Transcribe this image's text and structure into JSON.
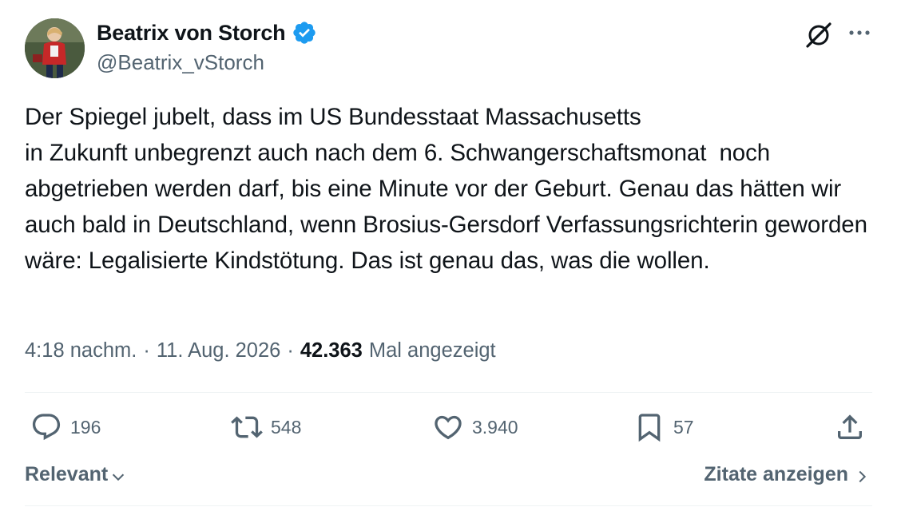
{
  "author": {
    "name": "Beatrix von Storch",
    "handle": "@Beatrix_vStorch",
    "verified_color": "#1d9bf0"
  },
  "tweet": {
    "text": "Der Spiegel jubelt, dass im US Bundesstaat Massachusetts\nin Zukunft unbegrenzt auch nach dem 6. Schwangerschaftsmonat  noch abgetrieben werden darf, bis eine Minute vor der Geburt. Genau das hätten wir auch bald in Deutschland, wenn Brosius-Gersdorf Verfassungsrichterin geworden wäre: Legalisierte Kindstötung. Das ist genau das, was die wollen.",
    "time": "4:18 nachm.",
    "date": "11. Aug. 2026",
    "separator": "·",
    "views": "42.363",
    "views_label": "Mal angezeigt"
  },
  "actions": {
    "replies": "196",
    "retweets": "548",
    "likes": "3.940",
    "bookmarks": "57"
  },
  "footer": {
    "sort_label": "Relevant",
    "quotes_label": "Zitate anzeigen"
  },
  "icons": [
    "grok-icon",
    "more-icon",
    "reply-icon",
    "retweet-icon",
    "like-icon",
    "bookmark-icon",
    "share-icon",
    "chevron-down-icon",
    "chevron-right-icon",
    "verified-icon"
  ]
}
